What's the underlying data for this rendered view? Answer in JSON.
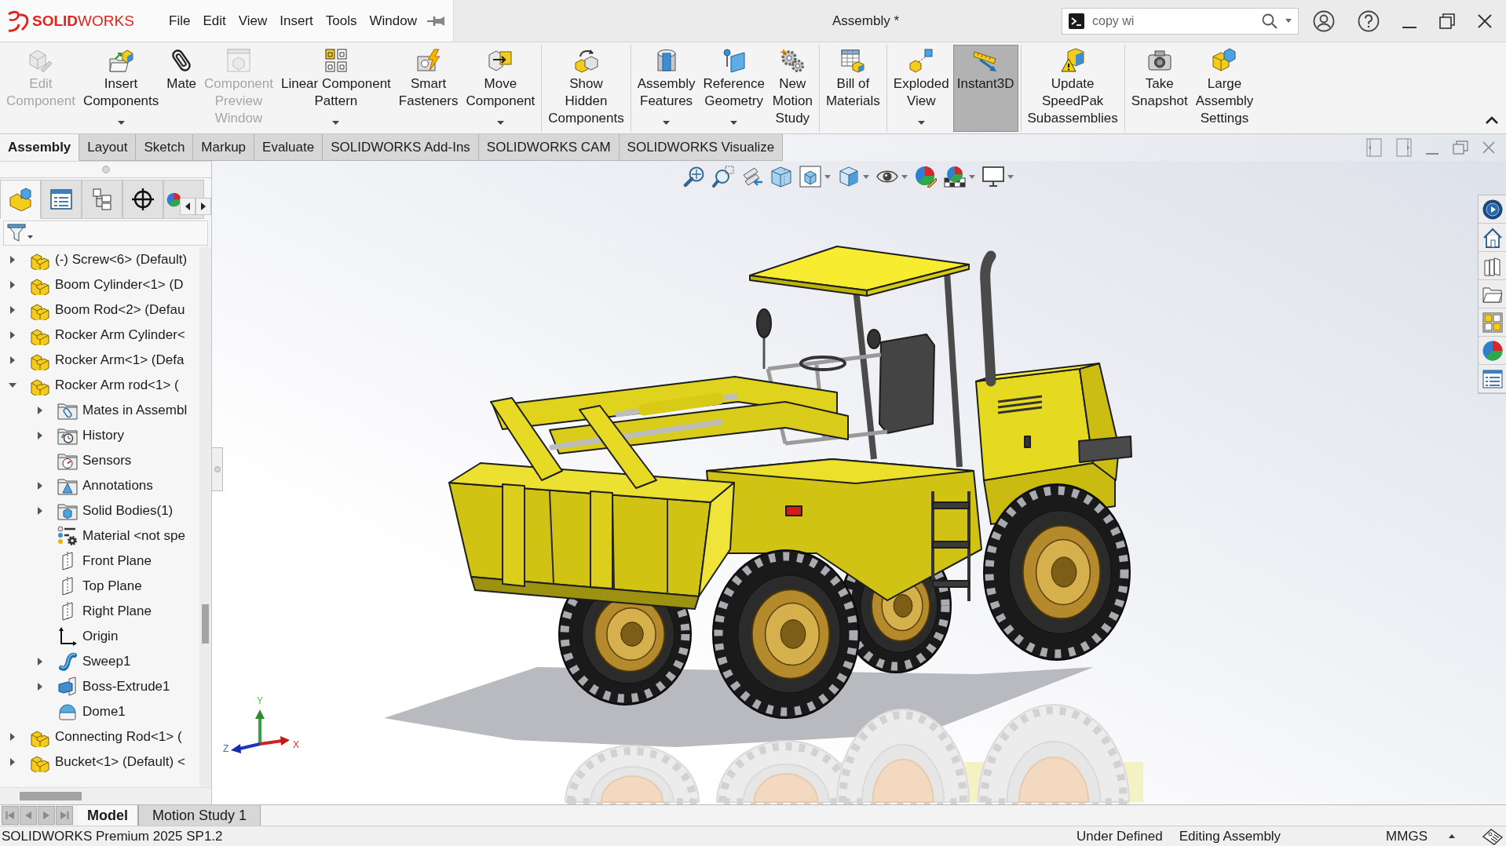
{
  "app": {
    "logo": "**SOLID**WORKS"
  },
  "menu": [
    "File",
    "Edit",
    "View",
    "Insert",
    "Tools",
    "Window"
  ],
  "window": {
    "title": "Assembly *"
  },
  "search": {
    "value": "copy wi"
  },
  "ribbon": {
    "groups": [
      {
        "items": [
          {
            "label": "Edit\nComponent",
            "kind": "edit-component",
            "disabled": true,
            "dropdown": false,
            "selected": false
          },
          {
            "label": "Insert\nComponents",
            "kind": "insert-components",
            "disabled": false,
            "dropdown": true,
            "selected": false
          },
          {
            "label": "Mate",
            "kind": "mate",
            "disabled": false,
            "dropdown": false,
            "selected": false
          },
          {
            "label": "Component\nPreview\nWindow",
            "kind": "preview-window",
            "disabled": true,
            "dropdown": false,
            "selected": false
          },
          {
            "label": "Linear Component\nPattern",
            "kind": "linear-pattern",
            "disabled": false,
            "dropdown": true,
            "selected": false
          },
          {
            "label": "Smart\nFasteners",
            "kind": "smart-fasteners",
            "disabled": false,
            "dropdown": false,
            "selected": false
          },
          {
            "label": "Move\nComponent",
            "kind": "move-component",
            "disabled": false,
            "dropdown": true,
            "selected": false
          }
        ]
      },
      {
        "items": [
          {
            "label": "Show\nHidden\nComponents",
            "kind": "show-hidden",
            "disabled": false,
            "dropdown": false,
            "selected": false
          }
        ]
      },
      {
        "items": [
          {
            "label": "Assembly\nFeatures",
            "kind": "assembly-features",
            "disabled": false,
            "dropdown": true,
            "selected": false
          },
          {
            "label": "Reference\nGeometry",
            "kind": "reference-geometry",
            "disabled": false,
            "dropdown": true,
            "selected": false
          },
          {
            "label": "New\nMotion\nStudy",
            "kind": "motion-study",
            "disabled": false,
            "dropdown": false,
            "selected": false
          }
        ]
      },
      {
        "items": [
          {
            "label": "Bill of\nMaterials",
            "kind": "bill-of-materials",
            "disabled": false,
            "dropdown": false,
            "selected": false
          }
        ]
      },
      {
        "items": [
          {
            "label": "Exploded\nView",
            "kind": "exploded-view",
            "disabled": false,
            "dropdown": true,
            "selected": false
          },
          {
            "label": "Instant3D",
            "kind": "instant3d",
            "disabled": false,
            "dropdown": false,
            "selected": true
          }
        ]
      },
      {
        "items": [
          {
            "label": "Update\nSpeedPak\nSubassemblies",
            "kind": "speedpak",
            "disabled": false,
            "dropdown": false,
            "selected": false
          }
        ]
      },
      {
        "items": [
          {
            "label": "Take\nSnapshot",
            "kind": "snapshot",
            "disabled": false,
            "dropdown": false,
            "selected": false
          },
          {
            "label": "Large\nAssembly\nSettings",
            "kind": "large-assembly",
            "disabled": false,
            "dropdown": false,
            "selected": false
          }
        ]
      }
    ]
  },
  "tabs": [
    {
      "label": "Assembly",
      "selected": true
    },
    {
      "label": "Layout",
      "selected": false
    },
    {
      "label": "Sketch",
      "selected": false
    },
    {
      "label": "Markup",
      "selected": false
    },
    {
      "label": "Evaluate",
      "selected": false
    },
    {
      "label": "SOLIDWORKS Add-Ins",
      "selected": false
    },
    {
      "label": "SOLIDWORKS CAM",
      "selected": false
    },
    {
      "label": "SOLIDWORKS Visualize",
      "selected": false
    }
  ],
  "feature_manager": {
    "panel_tabs": [
      {
        "kind": "feature-tree",
        "selected": true
      },
      {
        "kind": "property-manager",
        "selected": false
      },
      {
        "kind": "configuration-manager",
        "selected": false
      },
      {
        "kind": "dimxpert",
        "selected": false
      },
      {
        "kind": "display-manager",
        "selected": false
      }
    ],
    "tree": [
      {
        "label": "(-) Screw<6> (Default)",
        "kind": "part",
        "expanded": false
      },
      {
        "label": "Boom Cylinder<1> (D",
        "kind": "part",
        "expanded": false
      },
      {
        "label": "Boom Rod<2> (Defau",
        "kind": "part",
        "expanded": false
      },
      {
        "label": "Rocker Arm Cylinder<",
        "kind": "part",
        "expanded": false
      },
      {
        "label": "Rocker Arm<1> (Defa",
        "kind": "part",
        "expanded": false
      },
      {
        "label": "Rocker Arm rod<1> (",
        "kind": "part",
        "expanded": true,
        "children": [
          {
            "label": "Mates in Assembl",
            "kind": "mates-folder",
            "expanded": false
          },
          {
            "label": "History",
            "kind": "history-folder",
            "expanded": false
          },
          {
            "label": "Sensors",
            "kind": "sensors-folder"
          },
          {
            "label": "Annotations",
            "kind": "annotations-folder",
            "expanded": false
          },
          {
            "label": "Solid Bodies(1)",
            "kind": "bodies-folder",
            "expanded": false
          },
          {
            "label": "Material <not spe",
            "kind": "material"
          },
          {
            "label": "Front Plane",
            "kind": "plane"
          },
          {
            "label": "Top Plane",
            "kind": "plane"
          },
          {
            "label": "Right Plane",
            "kind": "plane"
          },
          {
            "label": "Origin",
            "kind": "origin"
          },
          {
            "label": "Sweep1",
            "kind": "sweep",
            "expanded": false
          },
          {
            "label": "Boss-Extrude1",
            "kind": "extrude",
            "expanded": false
          },
          {
            "label": "Dome1",
            "kind": "dome"
          }
        ]
      },
      {
        "label": "Connecting Rod<1> (",
        "kind": "part",
        "expanded": false
      },
      {
        "label": "Bucket<1> (Default) <",
        "kind": "part",
        "expanded": false
      }
    ]
  },
  "viewport": {
    "triad": {
      "x_label": "X",
      "y_label": "Y",
      "z_label": "Z"
    }
  },
  "model_tabs": [
    {
      "label": "Model",
      "selected": true
    },
    {
      "label": "Motion Study 1",
      "selected": false
    }
  ],
  "status_bar": {
    "product": "SOLIDWORKS Premium 2025 SP1.2",
    "definition": "Under Defined",
    "mode": "Editing Assembly",
    "units": "MMGS"
  }
}
